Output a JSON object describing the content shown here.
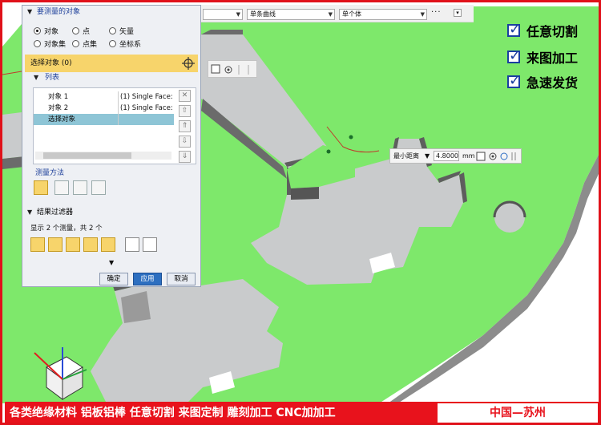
{
  "toolbar": {
    "combo2": "单条曲线",
    "combo3": "单个体",
    "more_label": "···"
  },
  "promo": {
    "items": [
      "任意切割",
      "来图加工",
      "急速发货"
    ]
  },
  "dialog": {
    "section_title": "要测量的对象",
    "options": {
      "object": "对象",
      "point": "点",
      "vector": "矢量",
      "object_set": "对象集",
      "point_set": "点集",
      "csys": "坐标系"
    },
    "select_label": "选择对象 (0)",
    "list_title": "列表",
    "list_rows": [
      {
        "name": "对象 1",
        "value": "(1) Single Face: I"
      },
      {
        "name": "对象 2",
        "value": "(1) Single Face: I"
      },
      {
        "name": "选择对象",
        "value": ""
      }
    ],
    "method_title": "测量方法",
    "filter_title": "结果过滤器",
    "filter_text": "显示 2 个测量，共 2 个",
    "ok": "确定",
    "apply": "应用",
    "cancel": "取消"
  },
  "measure": {
    "type": "最小距离",
    "value": "4.8000",
    "unit": "mm"
  },
  "banner": {
    "left": "各类绝缘材料  铝板铝棒  任意切割  来图定制  雕刻加工  CNC加加工",
    "right": "中国—苏州"
  },
  "colors": {
    "plate_green": "#7ee86b",
    "cut_gray": "#c9cbcc",
    "frame_red": "#e0111a",
    "accent_yellow": "#f7d46b"
  }
}
